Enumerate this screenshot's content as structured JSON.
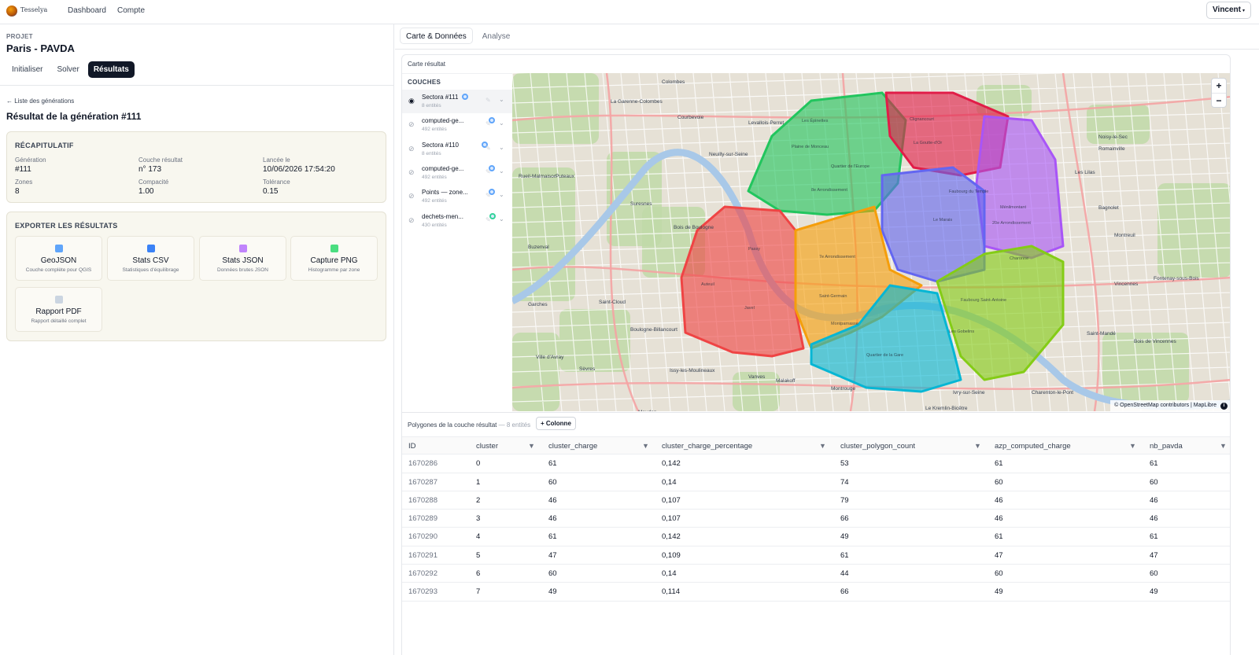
{
  "nav": {
    "brand": "Tesselya",
    "links": [
      "Dashboard",
      "Compte"
    ],
    "user": "Vincent",
    "user_caret": "▾"
  },
  "project": {
    "label": "PROJET",
    "name": "Paris - PAVDA",
    "steps": [
      "Initialiser",
      "Solver",
      "Résultats"
    ],
    "active_step": "Résultats"
  },
  "back_link": "← Liste des générations",
  "result_title": "Résultat de la génération #111",
  "summary": {
    "title": "RÉCAPITULATIF",
    "fields": [
      {
        "label": "Génération",
        "value": "#111"
      },
      {
        "label": "Couche résultat",
        "value": "n° 173"
      },
      {
        "label": "Lancée le",
        "value": "10/06/2026 17:54:20"
      },
      {
        "label": "Zones",
        "value": "8"
      },
      {
        "label": "Compacité",
        "value": "1.00"
      },
      {
        "label": "Tolérance",
        "value": "0.15"
      }
    ]
  },
  "export": {
    "title": "EXPORTER LES RÉSULTATS",
    "items": [
      {
        "name": "GeoJSON",
        "desc": "Couche complète pour QGIS",
        "icon": "map-icon",
        "color": "#60a5fa"
      },
      {
        "name": "Stats CSV",
        "desc": "Statistiques d'équilibrage",
        "icon": "bar-chart-icon",
        "color": "#3b82f6"
      },
      {
        "name": "Stats JSON",
        "desc": "Données brutes JSON",
        "icon": "clipboard-icon",
        "color": "#c084fc"
      },
      {
        "name": "Capture PNG",
        "desc": "Histogramme par zone",
        "icon": "image-icon",
        "color": "#4ade80"
      },
      {
        "name": "Rapport PDF",
        "desc": "Rapport détaillé complet",
        "icon": "document-icon",
        "color": "#cbd5e1"
      }
    ]
  },
  "tabs": [
    "Carte & Données",
    "Analyse"
  ],
  "active_tab": "Carte & Données",
  "map_card": {
    "title": "Carte résultat",
    "layers_title": "COUCHES",
    "layers": [
      {
        "name": "Sectora #111",
        "count": "8 entités",
        "visible": true,
        "badge": "#60a5fa"
      },
      {
        "name": "computed-ge...",
        "count": "492 entités",
        "visible": false,
        "badge": "#60a5fa"
      },
      {
        "name": "Sectora #110",
        "count": "8 entités",
        "visible": false,
        "badge": "#60a5fa"
      },
      {
        "name": "computed-ge...",
        "count": "492 entités",
        "visible": false,
        "badge": "#60a5fa"
      },
      {
        "name": "Points — zone...",
        "count": "492 entités",
        "visible": false,
        "badge": "#60a5fa"
      },
      {
        "name": "dechets-men...",
        "count": "430 entités",
        "visible": false,
        "badge": "#34d399"
      }
    ],
    "zoom_in": "+",
    "zoom_out": "−",
    "attribution": "© OpenStreetMap contributors | MapLibre",
    "info": "i",
    "place_labels": [
      "Colombes",
      "La Garenne-Colombes",
      "Courbevoie",
      "Levallois-Perret",
      "Neuilly-sur-Seine",
      "Puteaux",
      "Suresnes",
      "Bois de Boulogne",
      "Rueil-Malmaison",
      "Buzenval",
      "Garches",
      "Saint-Cloud",
      "Boulogne-Billancourt",
      "Ville d'Avray",
      "Sèvres",
      "Issy-les-Moulineaux",
      "Vanves",
      "Malakoff",
      "Montrouge",
      "Meudon",
      "Les Lilas",
      "Romainville",
      "Noisy-le-Sec",
      "Bagnolet",
      "Montreuil",
      "Vincennes",
      "Fontenay-sous-Bois",
      "Bois de Vincennes",
      "Saint-Mandé",
      "Charenton-le-Pont",
      "Ivry-sur-Seine",
      "Le Kremlin-Bicêtre"
    ],
    "zone_labels": [
      "Les Épinettes",
      "Plaine de Monceau",
      "Quartier de l'Europe",
      "8e Arrondissement",
      "Clignancourt",
      "La Goutte-d'Or",
      "Faubourg du Temple",
      "Le Marais",
      "Ménilmontant",
      "20e Arrondissement",
      "Passy",
      "Auteuil",
      "Javel",
      "7e Arrondissement",
      "Saint-Germain",
      "Montparnasse",
      "Faubourg Saint-Antoine",
      "Charonne",
      "Les Gobelins",
      "Quartier de la Gare"
    ]
  },
  "table": {
    "title": "Polygones de la couche résultat",
    "count": "— 8 entités",
    "add_column": "+ Colonne",
    "columns": [
      "ID",
      "cluster",
      "cluster_charge",
      "cluster_charge_percentage",
      "cluster_polygon_count",
      "azp_computed_charge",
      "nb_pavda"
    ],
    "rows": [
      [
        "1670286",
        "0",
        "61",
        "0,142",
        "53",
        "61",
        "61"
      ],
      [
        "1670287",
        "1",
        "60",
        "0,14",
        "74",
        "60",
        "60"
      ],
      [
        "1670288",
        "2",
        "46",
        "0,107",
        "79",
        "46",
        "46"
      ],
      [
        "1670289",
        "3",
        "46",
        "0,107",
        "66",
        "46",
        "46"
      ],
      [
        "1670290",
        "4",
        "61",
        "0,142",
        "49",
        "61",
        "61"
      ],
      [
        "1670291",
        "5",
        "47",
        "0,109",
        "61",
        "47",
        "47"
      ],
      [
        "1670292",
        "6",
        "60",
        "0,14",
        "44",
        "60",
        "60"
      ],
      [
        "1670293",
        "7",
        "49",
        "0,114",
        "66",
        "49",
        "49"
      ]
    ]
  },
  "zone_colors": [
    "#22c55e",
    "#ef4444",
    "#a855f7",
    "#6366f1",
    "#e11d48",
    "#f59e0b",
    "#06b6d4",
    "#84cc16"
  ]
}
